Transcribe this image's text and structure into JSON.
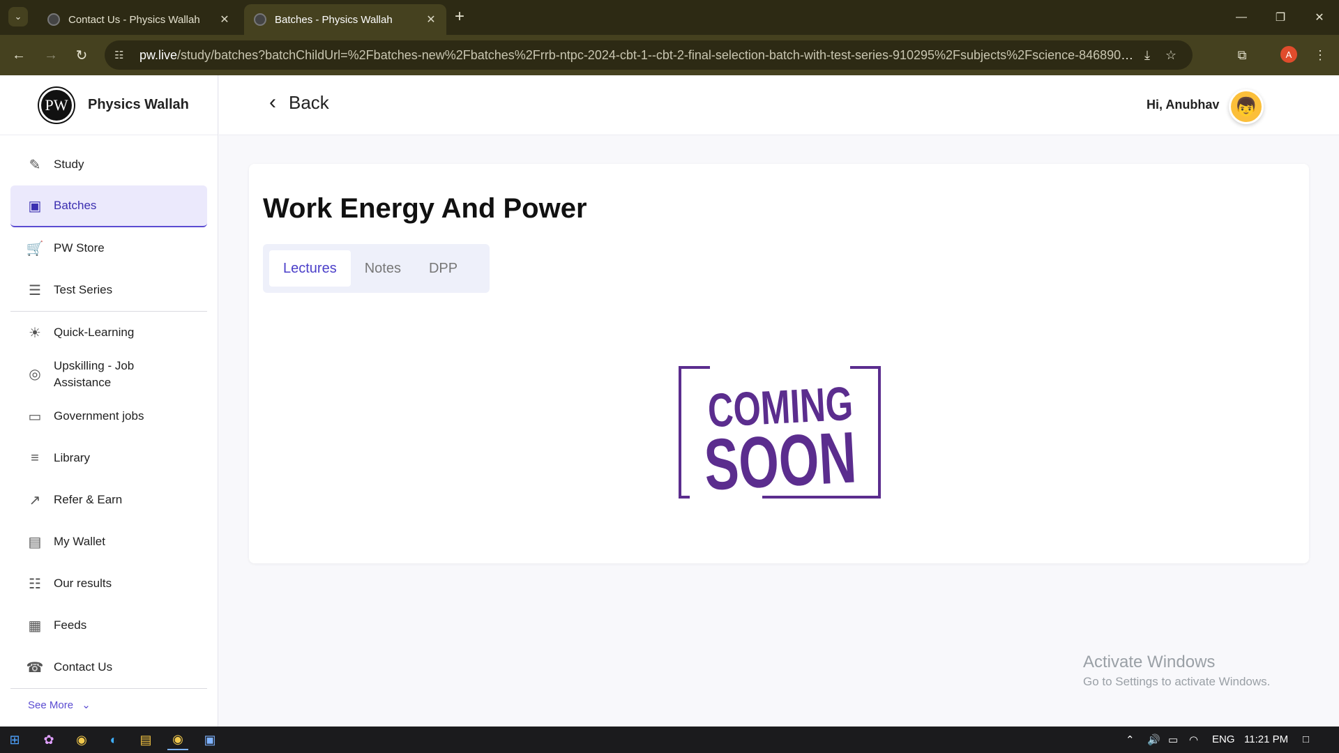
{
  "browser": {
    "tabs": [
      {
        "title": "Contact Us - Physics Wallah",
        "active": false
      },
      {
        "title": "Batches - Physics Wallah",
        "active": true
      }
    ],
    "url_host": "pw.live",
    "url_path": "/study/batches?batchChildUrl=%2Fbatches-new%2Fbatches%2Frrb-ntpc-2024-cbt-1--cbt-2-final-selection-batch-with-test-series-910295%2Fsubjects%2Fscience-846890%2Fsubjec...",
    "profile_initial": "A"
  },
  "brand": {
    "name": "Physics Wallah",
    "logo_text": "PW"
  },
  "sidebar": {
    "items": [
      {
        "label": "Study",
        "icon": "edit-icon"
      },
      {
        "label": "Batches",
        "icon": "batches-icon",
        "active": true
      },
      {
        "label": "PW Store",
        "icon": "cart-icon"
      },
      {
        "label": "Test Series",
        "icon": "document-icon"
      },
      {
        "label": "Quick-Learning",
        "icon": "bulb-icon"
      },
      {
        "label": "Upskilling - Job Assistance",
        "icon": "target-icon"
      },
      {
        "label": "Government jobs",
        "icon": "briefcase-icon"
      },
      {
        "label": "Library",
        "icon": "library-icon"
      },
      {
        "label": "Refer & Earn",
        "icon": "share-icon"
      },
      {
        "label": "My Wallet",
        "icon": "wallet-icon"
      },
      {
        "label": "Our results",
        "icon": "results-icon"
      },
      {
        "label": "Feeds",
        "icon": "feeds-icon"
      },
      {
        "label": "Contact Us",
        "icon": "phone-icon"
      }
    ],
    "see_more": "See More"
  },
  "header": {
    "back_label": "Back",
    "greeting": "Hi, Anubhav"
  },
  "main": {
    "title": "Work Energy And Power",
    "tabs": [
      {
        "label": "Lectures",
        "active": true
      },
      {
        "label": "Notes"
      },
      {
        "label": "DPP"
      }
    ],
    "placeholder_line1": "COMING",
    "placeholder_line2": "SOON",
    "placeholder_color": "#5b2d8e"
  },
  "watermark": {
    "heading": "Activate Windows",
    "sub": "Go to Settings to activate Windows."
  },
  "taskbar": {
    "language": "ENG",
    "time": "11:21 PM"
  },
  "colors": {
    "accent": "#5a4bd1",
    "active_bg": "#ebe9fc",
    "chrome_dark": "#2d2a14",
    "chrome_toolbar": "#45411f"
  }
}
